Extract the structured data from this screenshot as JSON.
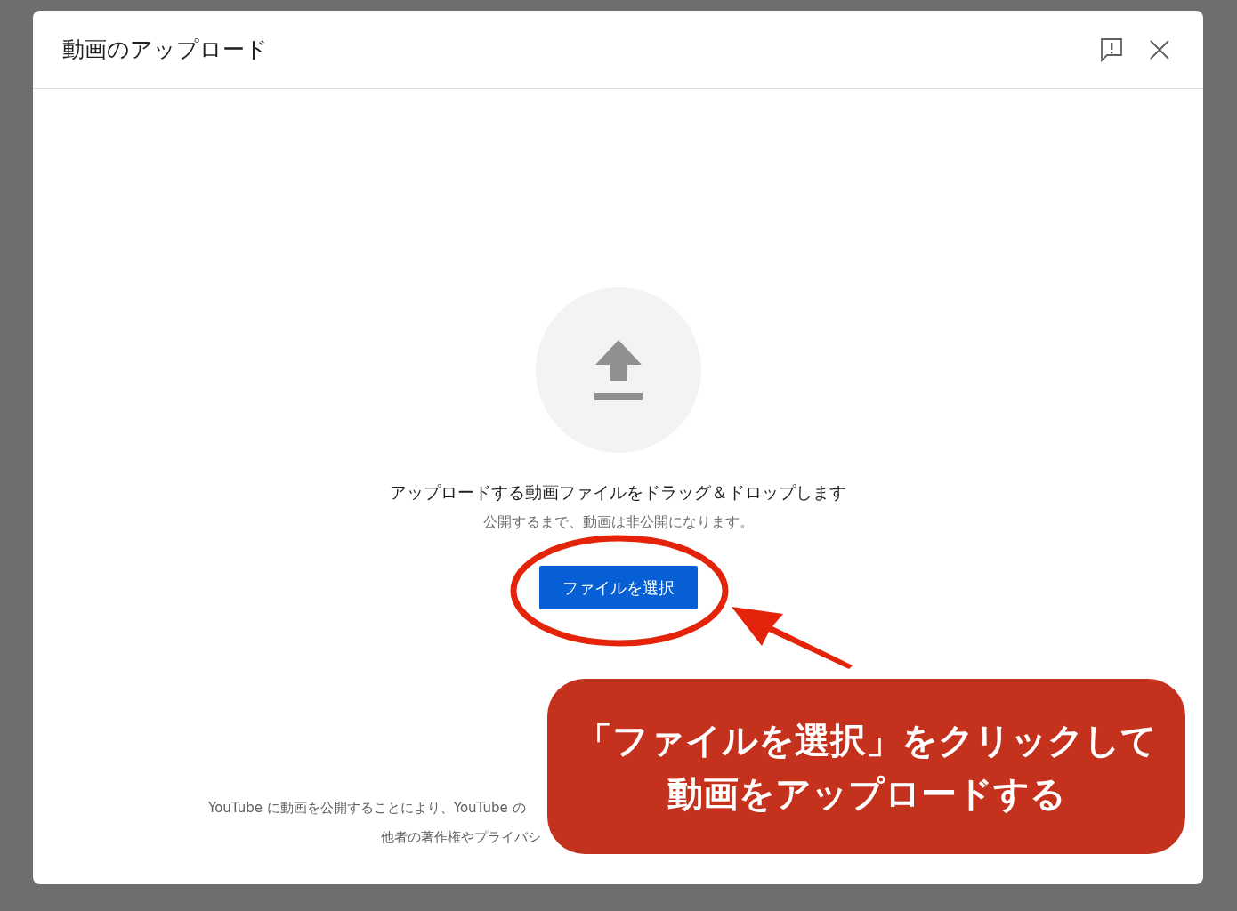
{
  "dialog": {
    "title": "動画のアップロード",
    "drop_text": "アップロードする動画ファイルをドラッグ＆ドロップします",
    "note": "公開するまで、動画は非公開になります。",
    "select_button": "ファイルを選択",
    "footer_lines": [
      "YouTube に動画を公開することにより、YouTube の",
      "他者の著作権やプライバシ"
    ]
  },
  "annotation": {
    "lines": [
      "「ファイルを選択」をクリックして",
      "動画をアップロードする"
    ]
  }
}
